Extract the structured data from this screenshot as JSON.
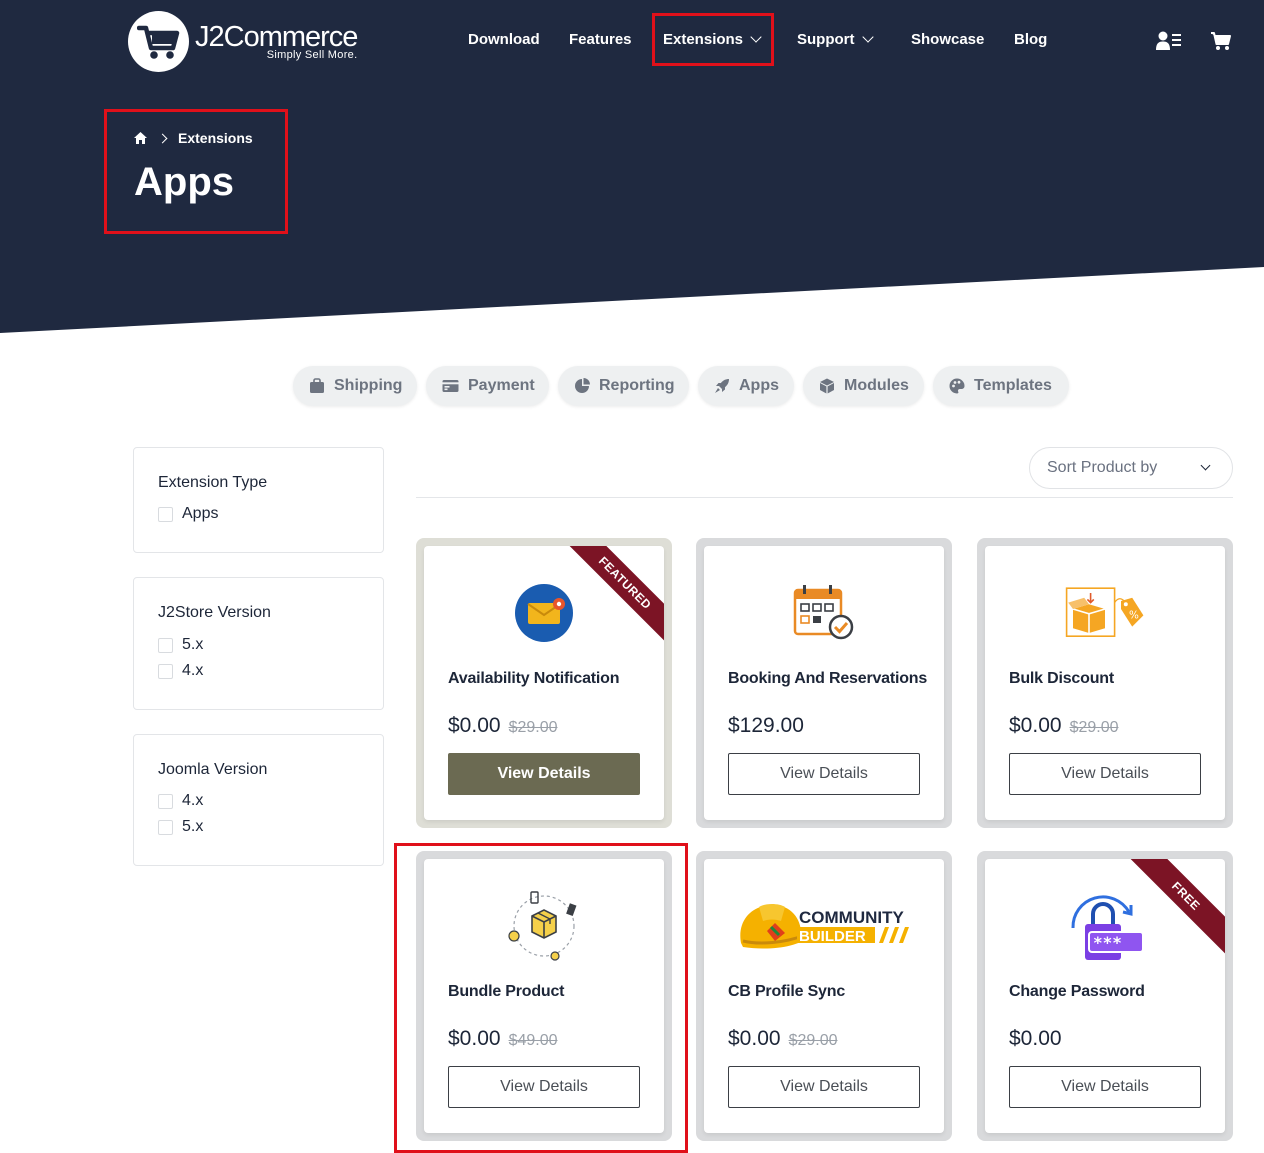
{
  "header": {
    "logo_name": "J2Commerce",
    "logo_tagline": "Simply Sell More.",
    "nav": [
      {
        "label": "Download"
      },
      {
        "label": "Features"
      },
      {
        "label": "Extensions"
      },
      {
        "label": "Support"
      },
      {
        "label": "Showcase"
      },
      {
        "label": "Blog"
      }
    ]
  },
  "breadcrumb": {
    "current": "Extensions"
  },
  "page_title": "Apps",
  "tabs": [
    {
      "label": "Shipping",
      "icon": "shopping-bag-icon"
    },
    {
      "label": "Payment",
      "icon": "credit-card-icon"
    },
    {
      "label": "Reporting",
      "icon": "pie-chart-icon"
    },
    {
      "label": "Apps",
      "icon": "rocket-icon"
    },
    {
      "label": "Modules",
      "icon": "cube-icon"
    },
    {
      "label": "Templates",
      "icon": "palette-icon"
    }
  ],
  "filters": [
    {
      "title": "Extension Type",
      "options": [
        "Apps"
      ]
    },
    {
      "title": "J2Store Version",
      "options": [
        "5.x",
        "4.x"
      ]
    },
    {
      "title": "Joomla Version",
      "options": [
        "4.x",
        "5.x"
      ]
    }
  ],
  "sort": {
    "label": "Sort Product by"
  },
  "products": [
    {
      "title": "Availability Notification",
      "price": "$0.00",
      "old_price": "$29.00",
      "button": "View Details",
      "ribbon": "FEATURED",
      "icon": "envelope-bell-icon"
    },
    {
      "title": "Booking And Reservations",
      "price": "$129.00",
      "old_price": "",
      "button": "View Details",
      "ribbon": "",
      "icon": "calendar-check-icon"
    },
    {
      "title": "Bulk Discount",
      "price": "$0.00",
      "old_price": "$29.00",
      "button": "View Details",
      "ribbon": "",
      "icon": "box-discount-icon"
    },
    {
      "title": "Bundle Product",
      "price": "$0.00",
      "old_price": "$49.00",
      "button": "View Details",
      "ribbon": "",
      "icon": "bundle-box-icon"
    },
    {
      "title": "CB Profile Sync",
      "price": "$0.00",
      "old_price": "$29.00",
      "button": "View Details",
      "ribbon": "",
      "icon": "community-builder-icon",
      "logo_line1": "COMMUNITY",
      "logo_line2": "BUILDER"
    },
    {
      "title": "Change Password",
      "price": "$0.00",
      "old_price": "",
      "button": "View Details",
      "ribbon": "FREE",
      "icon": "lock-password-icon"
    }
  ],
  "colors": {
    "hero": "#1f2940",
    "highlight": "#e0101a",
    "primary_button": "#6b6a52",
    "ribbon": "#7c1425"
  }
}
